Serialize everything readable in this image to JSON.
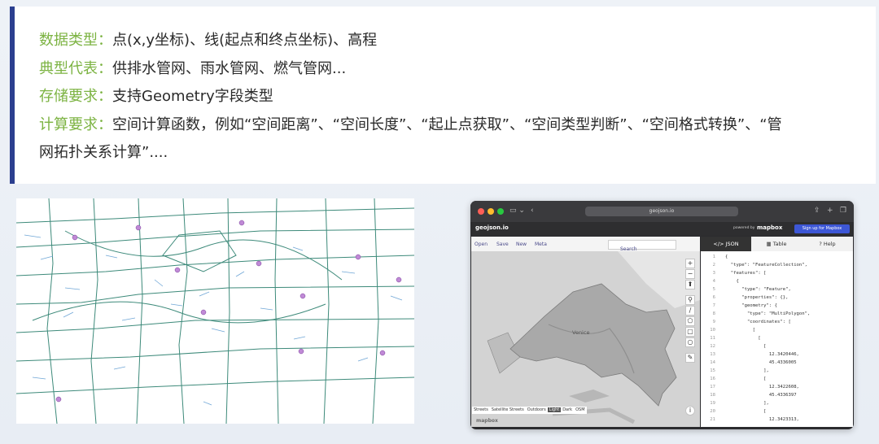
{
  "card": {
    "lines": [
      {
        "key": "数据类型：",
        "text": "点(x,y坐标)、线(起点和终点坐标)、高程"
      },
      {
        "key": "典型代表：",
        "text": "供排水管网、雨水管网、燃气管网..."
      },
      {
        "key": "存储要求：",
        "text": "支持Geometry字段类型"
      },
      {
        "key": "计算要求：",
        "text": "空间计算函数，例如“空间距离”、“空间长度”、“起止点获取”、“空间类型判断”、“空间格式转换”、“管"
      },
      {
        "key": "",
        "text": "网拓扑关系计算”...."
      }
    ]
  },
  "browser": {
    "url": "geojson.io",
    "brand": "geojson.io",
    "powered_by": "powered by",
    "mapbox": "mapbox",
    "signup": "Sign up for Mapbox",
    "map_tools": [
      "Open",
      "Save",
      "New",
      "Meta"
    ],
    "search_placeholder": "Search",
    "map_label": "Venice",
    "base_layers": [
      "Streets",
      "Satellite Streets",
      "Outdoors",
      "Light",
      "Dark",
      "OSM"
    ],
    "active_layer": "Light",
    "watermark": "mapbox",
    "tabs": [
      {
        "label": "</> JSON",
        "active": true
      },
      {
        "label": "Table",
        "active": false
      },
      {
        "label": "? Help",
        "active": false
      }
    ],
    "code": [
      {
        "n": "1",
        "t": "{"
      },
      {
        "n": "2",
        "t": "  \"type\": \"FeatureCollection\","
      },
      {
        "n": "3",
        "t": "  \"features\": ["
      },
      {
        "n": "4",
        "t": "    {"
      },
      {
        "n": "5",
        "t": "      \"type\": \"Feature\","
      },
      {
        "n": "6",
        "t": "      \"properties\": {},"
      },
      {
        "n": "7",
        "t": "      \"geometry\": {"
      },
      {
        "n": "8",
        "t": "        \"type\": \"MultiPolygon\","
      },
      {
        "n": "9",
        "t": "        \"coordinates\": ["
      },
      {
        "n": "10",
        "t": "          ["
      },
      {
        "n": "11",
        "t": "            ["
      },
      {
        "n": "12",
        "t": "              ["
      },
      {
        "n": "13",
        "t": "                12.3420446,"
      },
      {
        "n": "14",
        "t": "                45.4336005"
      },
      {
        "n": "15",
        "t": "              ],"
      },
      {
        "n": "16",
        "t": "              ["
      },
      {
        "n": "17",
        "t": "                12.3422608,"
      },
      {
        "n": "18",
        "t": "                45.4336397"
      },
      {
        "n": "19",
        "t": "              ],"
      },
      {
        "n": "20",
        "t": "              ["
      },
      {
        "n": "21",
        "t": "                12.3423313,"
      }
    ]
  },
  "colors": {
    "accent": "#7cb342",
    "card_bar": "#2b3f8f",
    "signup": "#3d57d6"
  }
}
